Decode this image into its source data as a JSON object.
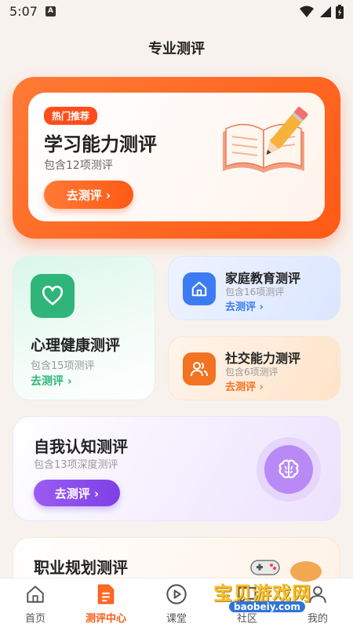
{
  "status_bar": {
    "time": "5:07",
    "indicator": "A"
  },
  "page_title": "专业测评",
  "hero": {
    "badge": "热门推荐",
    "title": "学习能力测评",
    "subtitle": "包含12项测评",
    "button": "去测评 ›"
  },
  "mental": {
    "title": "心理健康测评",
    "subtitle": "包含15项测评",
    "link": "去测评 ›"
  },
  "family": {
    "title": "家庭教育测评",
    "subtitle": "包含16项测评",
    "link": "去测评 ›"
  },
  "social": {
    "title": "社交能力测评",
    "subtitle": "包含6项测评",
    "link": "去测评 ›"
  },
  "self": {
    "title": "自我认知测评",
    "subtitle": "包含13项深度测评",
    "button": "去测评 ›"
  },
  "career": {
    "title": "职业规划测评"
  },
  "nav": {
    "items": [
      {
        "label": "首页",
        "icon": "home-icon"
      },
      {
        "label": "测评中心",
        "icon": "document-icon",
        "active": true
      },
      {
        "label": "课堂",
        "icon": "play-icon"
      },
      {
        "label": "社区",
        "icon": "community-icon"
      },
      {
        "label": "我的",
        "icon": "user-icon"
      }
    ]
  },
  "watermark": {
    "text": "宝贝游戏网",
    "url": "baobeiy.com"
  },
  "colors": {
    "brand_orange": "#ff5a16",
    "green": "#2fb57a",
    "blue": "#3d7bf2",
    "orange": "#f27321",
    "purple": "#8a4aec"
  }
}
